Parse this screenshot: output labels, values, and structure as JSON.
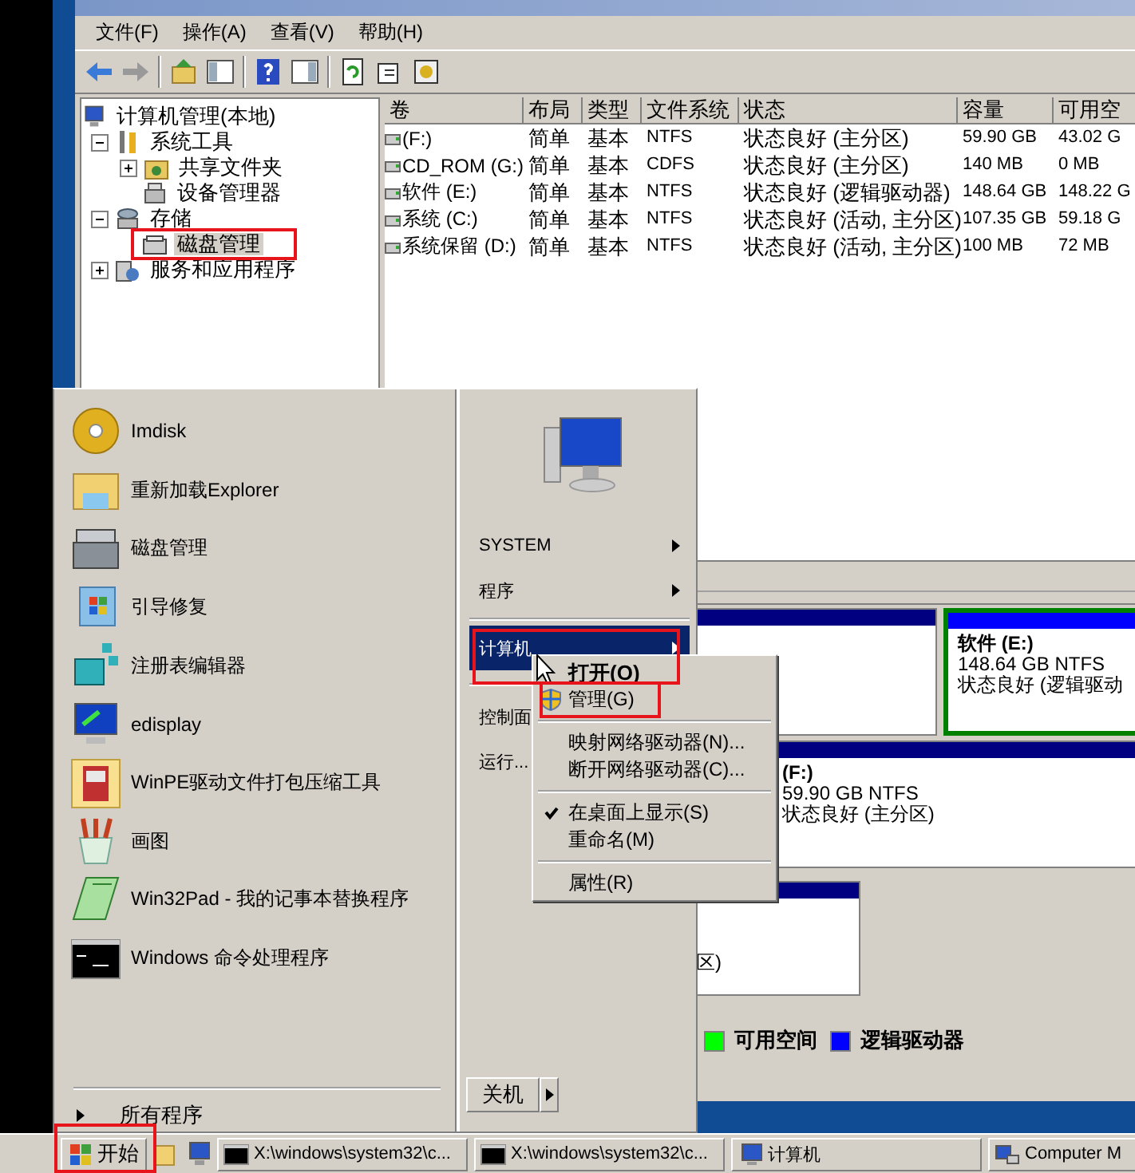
{
  "window": {
    "menu": [
      "文件(F)",
      "操作(A)",
      "查看(V)",
      "帮助(H)"
    ],
    "tree": [
      {
        "label": "计算机管理(本地)",
        "selected": false,
        "children": [
          {
            "label": "系统工具",
            "selected": false,
            "expanded": true,
            "children": [
              {
                "label": "共享文件夹",
                "selected": false,
                "expanded": false
              },
              {
                "label": "设备管理器",
                "selected": false
              }
            ]
          },
          {
            "label": "存储",
            "selected": false,
            "expanded": true,
            "children": [
              {
                "label": "磁盘管理",
                "selected": true
              }
            ]
          },
          {
            "label": "服务和应用程序",
            "selected": false,
            "expanded": false
          }
        ]
      }
    ],
    "volumes": {
      "columns": [
        "卷",
        "布局",
        "类型",
        "文件系统",
        "状态",
        "容量",
        "可用空"
      ],
      "rows": [
        [
          "(F:)",
          "简单",
          "基本",
          "NTFS",
          "状态良好 (主分区)",
          "59.90 GB",
          "43.02 G"
        ],
        [
          "CD_ROM (G:)",
          "简单",
          "基本",
          "CDFS",
          "状态良好 (主分区)",
          "140 MB",
          "0 MB"
        ],
        [
          "软件 (E:)",
          "简单",
          "基本",
          "NTFS",
          "状态良好 (逻辑驱动器)",
          "148.64 GB",
          "148.22 G"
        ],
        [
          "系统 (C:)",
          "简单",
          "基本",
          "NTFS",
          "状态良好 (活动, 主分区)",
          "107.35 GB",
          "59.18 G"
        ],
        [
          "系统保留 (D:)",
          "简单",
          "基本",
          "NTFS",
          "状态良好 (活动, 主分区)",
          "100 MB",
          "72 MB"
        ]
      ]
    },
    "disk_map": {
      "rows": [
        [
          {
            "kind": "primary"
          },
          {
            "kind": "logical",
            "name": "软件 (E:)",
            "size": "148.64 GB NTFS",
            "status": "状态良好 (逻辑驱动"
          }
        ],
        [
          {
            "kind": "primary",
            "name": "(F:)",
            "size": "59.90 GB NTFS",
            "status": "状态良好 (主分区)"
          }
        ],
        [
          {
            "kind": "primary",
            "status": "区)"
          }
        ]
      ],
      "legend": [
        {
          "label": "可用空间",
          "color": "#00ff00"
        },
        {
          "label": "逻辑驱动器",
          "color": "#0000ff"
        }
      ]
    }
  },
  "start_menu": {
    "programs": [
      "Imdisk",
      "重新加载Explorer",
      "磁盘管理",
      "引导修复",
      "注册表编辑器",
      "edisplay",
      "WinPE驱动文件打包压缩工具",
      "画图",
      "Win32Pad - 我的记事本替换程序",
      "Windows 命令处理程序"
    ],
    "all_programs": "所有程序",
    "places": [
      {
        "kind": "item",
        "label": "SYSTEM",
        "submenu": true,
        "selected": false
      },
      {
        "kind": "item",
        "label": "程序",
        "submenu": true,
        "selected": false
      },
      {
        "kind": "separator"
      },
      {
        "kind": "item",
        "label": "计算机",
        "submenu": true,
        "selected": true
      },
      {
        "kind": "separator"
      },
      {
        "kind": "item",
        "label": "控制面",
        "selected": false
      },
      {
        "kind": "item",
        "label": "运行...",
        "selected": false
      }
    ],
    "shutdown": "关机"
  },
  "context_menu": [
    {
      "kind": "item",
      "label": "打开(O)",
      "default": true,
      "elevated": false,
      "checked": false
    },
    {
      "kind": "item",
      "label": "管理(G)",
      "default": false,
      "elevated": true
    },
    {
      "kind": "separator"
    },
    {
      "kind": "item",
      "label": "映射网络驱动器(N)...",
      "default": false,
      "elevated": false,
      "checked": false
    },
    {
      "kind": "item",
      "label": "断开网络驱动器(C)...",
      "default": false,
      "elevated": false,
      "checked": false
    },
    {
      "kind": "separator"
    },
    {
      "kind": "item",
      "label": "在桌面上显示(S)",
      "default": false,
      "elevated": false,
      "checked": true
    },
    {
      "kind": "item",
      "label": "重命名(M)",
      "default": false,
      "elevated": false,
      "checked": false
    },
    {
      "kind": "separator"
    },
    {
      "kind": "item",
      "label": "属性(R)",
      "default": false,
      "elevated": false,
      "checked": false
    }
  ],
  "taskbar": {
    "start": "开始",
    "tasks": [
      {
        "kind": "console",
        "label": "X:\\windows\\system32\\c..."
      },
      {
        "kind": "console",
        "label": "X:\\windows\\system32\\c..."
      },
      {
        "kind": "computer",
        "label": "计算机"
      },
      {
        "kind": "management",
        "label": "Computer M"
      }
    ]
  }
}
